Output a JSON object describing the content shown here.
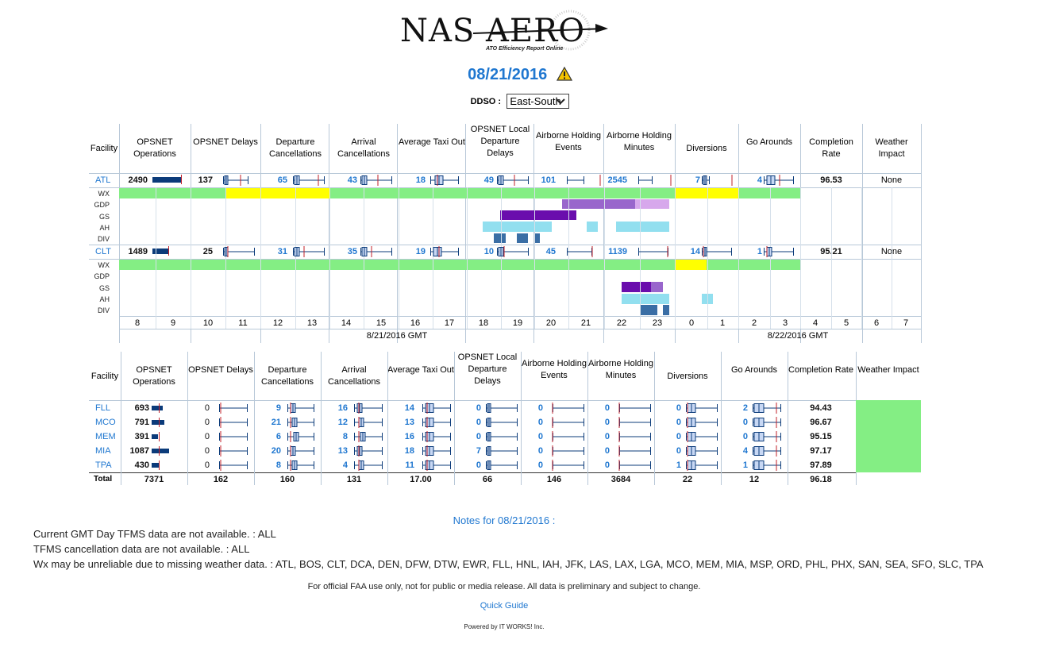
{
  "logo": {
    "title": "NAS AERO",
    "subtitle": "ATO Efficiency Report Online"
  },
  "date_title": "08/21/2016",
  "ddso": {
    "label": "DDSO :",
    "selected": "East-South"
  },
  "colors": {
    "link_blue": "#1f77d0",
    "wx_green": "#84ee84",
    "wx_yellow": "#ffff00",
    "gdp": "#9966cc",
    "gdp_light": "#d7a8ec",
    "gs": "#6a0dad",
    "ah": "#92dfef",
    "div": "#3a6ea5",
    "bar_navy": "#0b3b7a",
    "median_red": "#c0202a"
  },
  "table1": {
    "headers": [
      "Facility",
      "OPSNET Operations",
      "OPSNET Delays",
      "Departure Cancellations",
      "Arrival Cancellations",
      "Average Taxi Out",
      "OPSNET Local Departure Delays",
      "Airborne Holding Events",
      "Airborne Holding Minutes",
      "Diversions",
      "Go Arounds",
      "Completion Rate",
      "Weather Impact"
    ],
    "sub_labels": [
      "WX",
      "GDP",
      "GS",
      "AH",
      "DIV"
    ],
    "rows": [
      {
        "facility": "ATL",
        "operations": "2490",
        "delays": "137",
        "dep_cancel": "65",
        "arr_cancel": "43",
        "taxi_out": "18",
        "local_dep": "49",
        "ah_events": "101",
        "ah_minutes": "2545",
        "diversions": "7",
        "go_arounds": "4",
        "completion": "96.53",
        "weather": "None"
      },
      {
        "facility": "CLT",
        "operations": "1489",
        "delays": "25",
        "dep_cancel": "31",
        "arr_cancel": "35",
        "taxi_out": "19",
        "local_dep": "10",
        "ah_events": "45",
        "ah_minutes": "1139",
        "diversions": "14",
        "go_arounds": "1",
        "completion": "95.21",
        "weather": "None"
      }
    ],
    "hours": [
      "8",
      "9",
      "10",
      "11",
      "12",
      "13",
      "14",
      "15",
      "16",
      "17",
      "18",
      "19",
      "20",
      "21",
      "22",
      "23",
      "0",
      "1",
      "2",
      "3",
      "4",
      "5",
      "6",
      "7"
    ],
    "day1_label": "8/21/2016 GMT",
    "day2_label": "8/22/2016 GMT"
  },
  "table2": {
    "headers": [
      "Facility",
      "OPSNET Operations",
      "OPSNET Delays",
      "Departure Cancellations",
      "Arrival Cancellations",
      "Average Taxi Out",
      "OPSNET Local Departure Delays",
      "Airborne Holding Events",
      "Airborne Holding Minutes",
      "Diversions",
      "Go Arounds",
      "Completion Rate",
      "Weather Impact"
    ],
    "rows": [
      {
        "facility": "FLL",
        "operations": "693",
        "delays": "0",
        "dep_cancel": "9",
        "arr_cancel": "16",
        "taxi_out": "14",
        "local_dep": "0",
        "ah_events": "0",
        "ah_minutes": "0",
        "diversions": "0",
        "go_arounds": "2",
        "completion": "94.43"
      },
      {
        "facility": "MCO",
        "operations": "791",
        "delays": "0",
        "dep_cancel": "21",
        "arr_cancel": "12",
        "taxi_out": "13",
        "local_dep": "0",
        "ah_events": "0",
        "ah_minutes": "0",
        "diversions": "0",
        "go_arounds": "0",
        "completion": "96.67"
      },
      {
        "facility": "MEM",
        "operations": "391",
        "delays": "0",
        "dep_cancel": "6",
        "arr_cancel": "8",
        "taxi_out": "16",
        "local_dep": "0",
        "ah_events": "0",
        "ah_minutes": "0",
        "diversions": "0",
        "go_arounds": "0",
        "completion": "95.15"
      },
      {
        "facility": "MIA",
        "operations": "1087",
        "delays": "0",
        "dep_cancel": "20",
        "arr_cancel": "13",
        "taxi_out": "18",
        "local_dep": "7",
        "ah_events": "0",
        "ah_minutes": "0",
        "diversions": "0",
        "go_arounds": "4",
        "completion": "97.17"
      },
      {
        "facility": "TPA",
        "operations": "430",
        "delays": "0",
        "dep_cancel": "8",
        "arr_cancel": "4",
        "taxi_out": "11",
        "local_dep": "0",
        "ah_events": "0",
        "ah_minutes": "0",
        "diversions": "1",
        "go_arounds": "1",
        "completion": "97.89"
      }
    ],
    "total": {
      "label": "Total",
      "operations": "7371",
      "delays": "162",
      "dep_cancel": "160",
      "arr_cancel": "131",
      "taxi_out": "17.00",
      "local_dep": "66",
      "ah_events": "146",
      "ah_minutes": "3684",
      "diversions": "22",
      "go_arounds": "12",
      "completion": "96.18"
    }
  },
  "notes": {
    "title": "Notes for 08/21/2016 :",
    "lines": [
      "Current GMT Day TFMS data are not available. : ALL",
      "TFMS cancellation data are not available. : ALL",
      "Wx may be unreliable due to missing weather data. : ATL, BOS, CLT, DCA, DEN, DFW, DTW, EWR, FLL, HNL, IAH, JFK, LAS, LAX, LGA, MCO, MEM, MIA, MSP, ORD, PHL, PHX, SAN, SEA, SFO, SLC, TPA"
    ]
  },
  "footer": {
    "disclaimer": "For official FAA use only, not for public or media release. All data is preliminary and subject to change.",
    "quick_guide": "Quick Guide",
    "powered": "Powered by IT WORKS! Inc."
  }
}
